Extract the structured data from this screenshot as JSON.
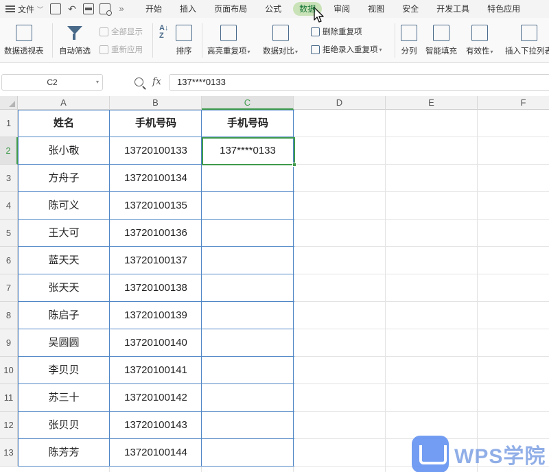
{
  "menubar": {
    "file_label": "文件",
    "tabs": [
      {
        "label": "开始"
      },
      {
        "label": "插入"
      },
      {
        "label": "页面布局"
      },
      {
        "label": "公式"
      },
      {
        "label": "数据",
        "active": true
      },
      {
        "label": "审阅"
      },
      {
        "label": "视图"
      },
      {
        "label": "安全"
      },
      {
        "label": "开发工具"
      },
      {
        "label": "特色应用"
      }
    ]
  },
  "ribbon": {
    "pivot_table": "数据透视表",
    "auto_filter": "自动筛选",
    "show_all": "全部显示",
    "reapply": "重新应用",
    "sort": "排序",
    "highlight_duplicates": "高亮重复项",
    "compare_data": "数据对比",
    "remove_duplicates": "删除重复项",
    "reject_duplicates": "拒绝录入重复项",
    "split": "分列",
    "smart_fill": "智能填充",
    "validity": "有效性",
    "insert_dropdown": "插入下拉列表"
  },
  "formula_bar": {
    "name_box": "C2",
    "fx_label": "fx",
    "content": "137****0133"
  },
  "sheet": {
    "columns": [
      "A",
      "B",
      "C",
      "D",
      "E",
      "F"
    ],
    "selected_column": "C",
    "selected_row": "2",
    "rows": [
      {
        "num": "1",
        "a": "姓名",
        "b": "手机号码",
        "c": "手机号码"
      },
      {
        "num": "2",
        "a": "张小敬",
        "b": "13720100133",
        "c": "137****0133"
      },
      {
        "num": "3",
        "a": "方舟子",
        "b": "13720100134",
        "c": ""
      },
      {
        "num": "4",
        "a": "陈可义",
        "b": "13720100135",
        "c": ""
      },
      {
        "num": "5",
        "a": "王大可",
        "b": "13720100136",
        "c": ""
      },
      {
        "num": "6",
        "a": "蓝天天",
        "b": "13720100137",
        "c": ""
      },
      {
        "num": "7",
        "a": "张天天",
        "b": "13720100138",
        "c": ""
      },
      {
        "num": "8",
        "a": "陈启子",
        "b": "13720100139",
        "c": ""
      },
      {
        "num": "9",
        "a": "吴圆圆",
        "b": "13720100140",
        "c": ""
      },
      {
        "num": "10",
        "a": "李贝贝",
        "b": "13720100141",
        "c": ""
      },
      {
        "num": "11",
        "a": "苏三十",
        "b": "13720100142",
        "c": ""
      },
      {
        "num": "12",
        "a": "张贝贝",
        "b": "13720100143",
        "c": ""
      },
      {
        "num": "13",
        "a": "陈芳芳",
        "b": "13720100144",
        "c": ""
      }
    ]
  },
  "watermark": {
    "text": "WPS学院"
  },
  "colors": {
    "selection_green": "#3f9a4b",
    "table_border_blue": "#4f86c6",
    "active_tab_bg": "#c9e2b8"
  }
}
